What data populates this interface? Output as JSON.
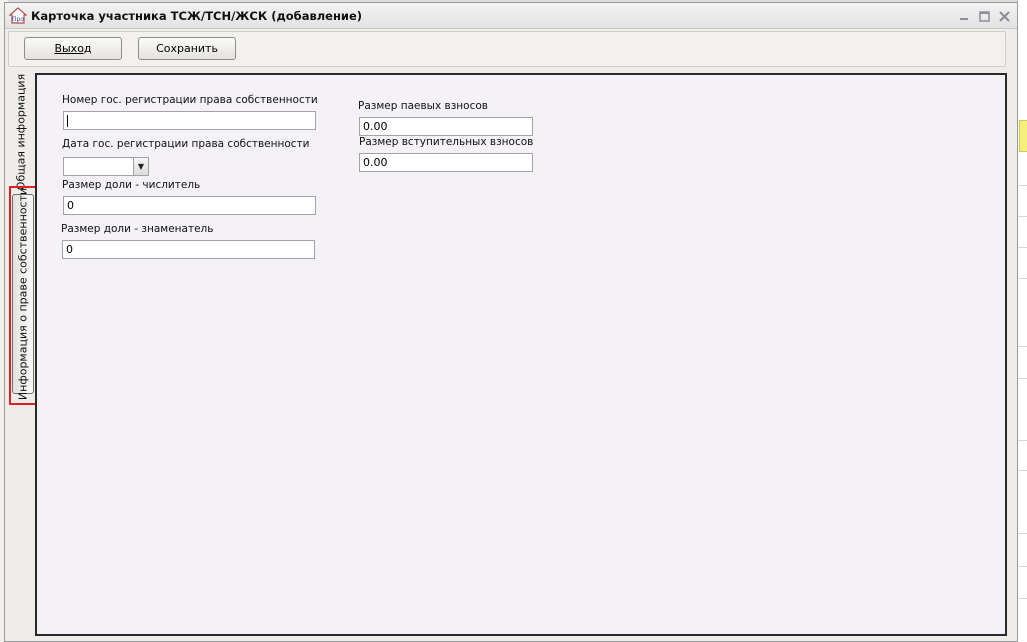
{
  "window": {
    "title": "Карточка участника ТСЖ/ТСН/ЖСК (добавление)",
    "icon_text": "Про",
    "controls": {
      "minimize": "minimize-icon",
      "maximize": "maximize-icon",
      "close": "close-icon"
    }
  },
  "toolbar": {
    "exit_label": "Выход",
    "save_label": "Сохранить"
  },
  "tabs": [
    {
      "label": "Общая информация",
      "active": false
    },
    {
      "label": "Информация о праве собственности",
      "active": true
    }
  ],
  "form": {
    "reg_number": {
      "label": "Номер гос. регистрации права собственности",
      "value": ""
    },
    "reg_date": {
      "label": "Дата гос. регистрации права собственности",
      "value": ""
    },
    "share_numerator": {
      "label": "Размер доли - числитель",
      "value": "0"
    },
    "share_denominator": {
      "label": "Размер доли - знаменатель",
      "value": "0"
    },
    "share_contributions": {
      "label": "Размер паевых взносов",
      "value": "0.00"
    },
    "entrance_contributions": {
      "label": "Размер вступительных взносов",
      "value": "0.00"
    }
  },
  "colors": {
    "highlight": "#e02020",
    "panel_bg": "#f4f2f6",
    "window_bg": "#efedea"
  }
}
